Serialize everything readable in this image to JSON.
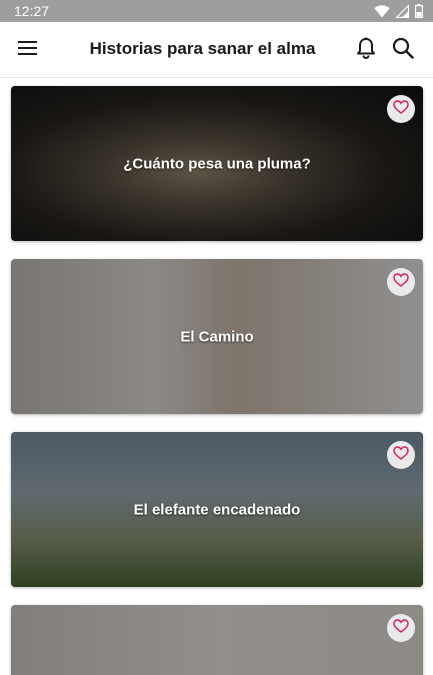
{
  "status_bar": {
    "time": "12:27",
    "icons": [
      "wifi-icon",
      "signal-icon",
      "battery-icon"
    ]
  },
  "app_bar": {
    "title": "Historias para sanar el alma",
    "icons": [
      "menu-icon",
      "bell-icon",
      "search-icon"
    ]
  },
  "stories": [
    {
      "title": "¿Cuánto pesa una pluma?",
      "favorite": false
    },
    {
      "title": "El Camino",
      "favorite": false
    },
    {
      "title": "El elefante encadenado",
      "favorite": false
    },
    {
      "title": "",
      "favorite": false
    }
  ],
  "colors": {
    "status_bar": "#9e9e9e",
    "heart": "#d81b60",
    "fav_bg": "#eaeaea",
    "title_text": "#1a1a1a"
  }
}
